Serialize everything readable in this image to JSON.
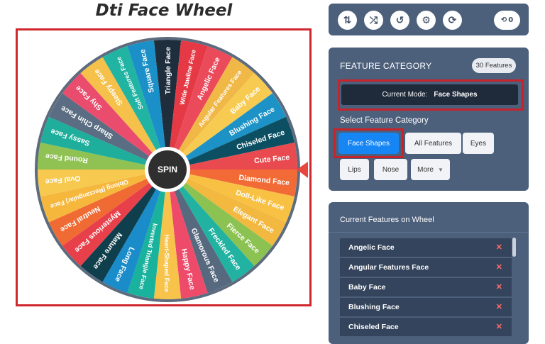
{
  "title": "Dti Face Wheel",
  "wheel": {
    "center_label": "SPIN",
    "segments": [
      {
        "label": "Triangle Face",
        "color": "#1f2e3d"
      },
      {
        "label": "Wide Jawline Face",
        "color": "#e53a45"
      },
      {
        "label": "Angelic Face",
        "color": "#ea4a5a"
      },
      {
        "label": "Angular Features Face",
        "color": "#f0b846"
      },
      {
        "label": "Baby Face",
        "color": "#f7cb52"
      },
      {
        "label": "Blushing Face",
        "color": "#1c92c6"
      },
      {
        "label": "Chiseled Face",
        "color": "#0d4f62"
      },
      {
        "label": "Cute Face",
        "color": "#e84a4f"
      },
      {
        "label": "Diamond Face",
        "color": "#f26a36"
      },
      {
        "label": "Doll-Like Face",
        "color": "#f8c144"
      },
      {
        "label": "Elegant Face",
        "color": "#f2b83f"
      },
      {
        "label": "Fierce Face",
        "color": "#8cc251"
      },
      {
        "label": "Freckled Face",
        "color": "#22b2a1"
      },
      {
        "label": "Glamorous Face",
        "color": "#56697e"
      },
      {
        "label": "Happy Face",
        "color": "#ee4a6a"
      },
      {
        "label": "Heart-Shaped Face",
        "color": "#f7c34b"
      },
      {
        "label": "Inverted Triangle Face",
        "color": "#19b29c"
      },
      {
        "label": "Long Face",
        "color": "#1a8cc9"
      },
      {
        "label": "Mature Face",
        "color": "#0f3f4c"
      },
      {
        "label": "Mysterious Face",
        "color": "#e8404a"
      },
      {
        "label": "Neutral Face",
        "color": "#f06a34"
      },
      {
        "label": "Oblong (Rectangular) Face",
        "color": "#f6b73d"
      },
      {
        "label": "Oval Face",
        "color": "#f7c94f"
      },
      {
        "label": "Round Face",
        "color": "#8fc253"
      },
      {
        "label": "Sassy Face",
        "color": "#1fae9b"
      },
      {
        "label": "Sharp Chin Face",
        "color": "#5a6d82"
      },
      {
        "label": "Shy Face",
        "color": "#e94c6c"
      },
      {
        "label": "Sleepy Face",
        "color": "#f6c14a"
      },
      {
        "label": "Soft Features Face",
        "color": "#21b4a3"
      },
      {
        "label": "Square Face",
        "color": "#1b90c8"
      }
    ]
  },
  "toolbar": {
    "icons": [
      "sort-icon",
      "shuffle-icon",
      "history-icon",
      "settings-icon",
      "refresh-icon"
    ],
    "spin_count": "0"
  },
  "category": {
    "title": "FEATURE CATEGORY",
    "count_badge": "30 Features",
    "mode_label": "Current Mode:",
    "mode_value": "Face Shapes",
    "select_label": "Select Feature Category",
    "buttons": {
      "face_shapes": "Face Shapes",
      "all_features": "All Features",
      "eyes": "Eyes",
      "lips": "Lips",
      "nose": "Nose",
      "more": "More"
    }
  },
  "features": {
    "title": "Current Features on Wheel",
    "items": [
      "Angelic Face",
      "Angular Features Face",
      "Baby Face",
      "Blushing Face",
      "Chiseled Face"
    ]
  },
  "colors": {
    "panel_bg": "#4c5f7b",
    "highlight_red": "#c8232b",
    "active_blue": "#1686f4"
  }
}
